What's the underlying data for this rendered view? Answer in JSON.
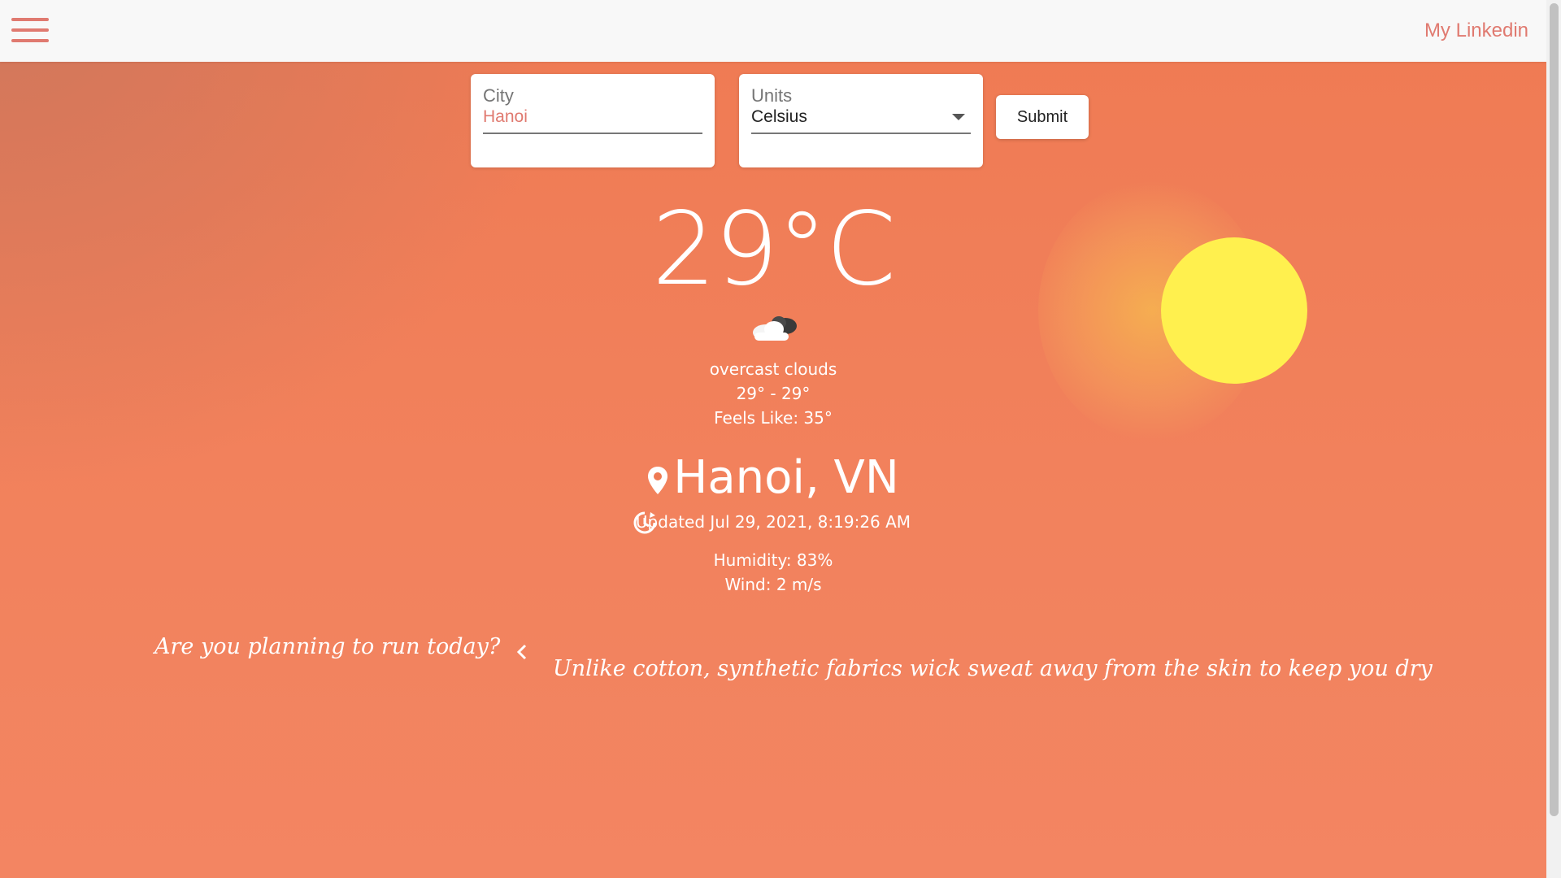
{
  "nav": {
    "menu_icon": "hamburger-menu-icon",
    "link_label": "My Linkedin"
  },
  "form": {
    "city_label": "City",
    "city_value": "Hanoi",
    "units_label": "Units",
    "units_value": "Celsius",
    "submit_label": "Submit"
  },
  "weather": {
    "temperature": "29°C",
    "icon": "overcast-cloud-icon",
    "description": "overcast clouds",
    "range": "29° - 29°",
    "feels_like": "Feels Like: 35°",
    "location": "Hanoi, VN",
    "updated": "Updated Jul 29, 2021, 8:19:26 AM",
    "humidity": "Humidity: 83%",
    "wind": "Wind: 2 m/s"
  },
  "tips": {
    "question": "Are you planning to run today?",
    "tip": "Unlike cotton, synthetic fabrics wick sweat away from the skin to keep you dry"
  },
  "colors": {
    "accent": "#e07a70",
    "background": "#ef7a53",
    "sun": "#fff04e"
  }
}
